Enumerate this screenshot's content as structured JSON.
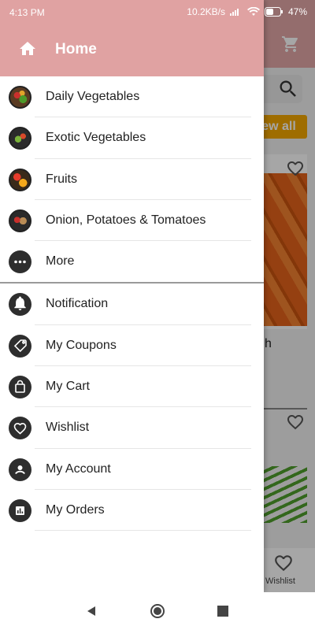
{
  "status_bar": {
    "time": "4:13 PM",
    "network_speed": "10.2KB/s",
    "battery": "47%"
  },
  "drawer": {
    "header_title": "Home",
    "category_items": [
      {
        "label": "Daily Vegetables",
        "icon": "vegetables-thumbnail-icon"
      },
      {
        "label": "Exotic Vegetables",
        "icon": "exotic-vegetables-thumbnail-icon"
      },
      {
        "label": "Fruits",
        "icon": "fruits-thumbnail-icon"
      },
      {
        "label": "Onion, Potatoes & Tomatoes",
        "icon": "onion-potatoes-tomatoes-thumbnail-icon"
      },
      {
        "label": "More",
        "icon": "more-dots-icon"
      }
    ],
    "account_items": [
      {
        "label": "Notification",
        "icon": "bell-icon"
      },
      {
        "label": "My Coupons",
        "icon": "coupon-tag-icon"
      },
      {
        "label": "My Cart",
        "icon": "shopping-bag-icon"
      },
      {
        "label": "Wishlist",
        "icon": "heart-icon"
      },
      {
        "label": "My Account",
        "icon": "account-icon"
      },
      {
        "label": "My Orders",
        "icon": "orders-chart-icon"
      }
    ]
  },
  "background": {
    "view_all_label": "ew all",
    "partial_text": "h",
    "bottom_nav_wishlist": "Wishlist"
  },
  "colors": {
    "drawer_header": "#e0a2a2",
    "view_all": "#f5a800"
  }
}
